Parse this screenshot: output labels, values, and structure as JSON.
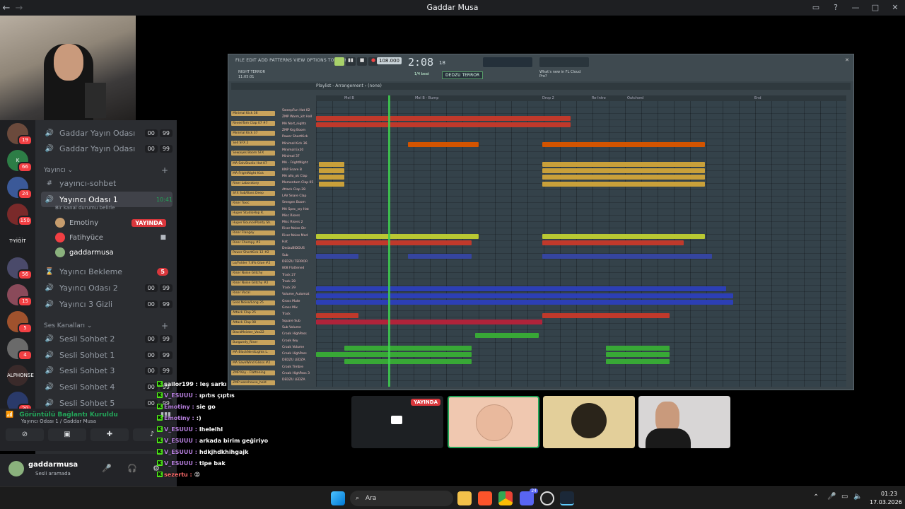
{
  "window": {
    "title": "Gaddar Musa"
  },
  "servers": [
    {
      "badge": "19",
      "color": "#6b4a3c"
    },
    {
      "badge": "66",
      "color": "#2d7d46",
      "label": "K"
    },
    {
      "badge": "24",
      "color": "#3b5998"
    },
    {
      "badge": "150",
      "color": "#7a2a2a"
    },
    {
      "label": "T-YİĞİT",
      "color": "#1e1f22"
    },
    {
      "badge": "56",
      "color": "#4a4a6a"
    },
    {
      "badge": "15",
      "color": "#8a4a5a"
    },
    {
      "badge": "5",
      "color": "#a0522d"
    },
    {
      "badge": "4",
      "color": "#6a6a6a"
    },
    {
      "label": "ALPHONSE",
      "color": "#3a2a2a"
    },
    {
      "badge": "20",
      "color": "#2a3a6a"
    }
  ],
  "channels": {
    "top_items": [
      {
        "label": "Gaddar Yayın Odası",
        "left": "00",
        "right": "99"
      },
      {
        "label": "Gaddar Yayın Odası",
        "left": "00",
        "right": "99"
      }
    ],
    "streamer_category": "Yayıncı",
    "text_channel": "yayıncı-sohbet",
    "active_room": {
      "label": "Yayıncı Odası 1",
      "time": "10:41",
      "status": "Bir kanal durumu belirle"
    },
    "users": [
      {
        "name": "Emotiny",
        "live": "YAYINDA",
        "color": "#c69c6d"
      },
      {
        "name": "Fatihyüce",
        "color": "#f23f43"
      },
      {
        "name": "gaddarmusa",
        "color": "#8ab17d"
      }
    ],
    "waiting": {
      "label": "Yayıncı Bekleme",
      "badge": "5"
    },
    "rooms": [
      {
        "label": "Yayıncı Odası 2",
        "left": "00",
        "right": "99"
      },
      {
        "label": "Yayıncı 3 Gizli",
        "left": "00",
        "right": "99"
      }
    ],
    "voice_category": "Ses Kanalları",
    "voice_rooms": [
      {
        "label": "Sesli Sohbet 2",
        "left": "00",
        "right": "99"
      },
      {
        "label": "Sesli Sohbet 1",
        "left": "00",
        "right": "99"
      },
      {
        "label": "Sesli Sohbet 3",
        "left": "00",
        "right": "99"
      },
      {
        "label": "Sesli Sohbet 4",
        "left": "00",
        "right": "99"
      },
      {
        "label": "Sesli Sohbet 5",
        "left": "00",
        "right": "99"
      }
    ]
  },
  "voice_panel": {
    "status": "Görüntülü Bağlantı Kuruldu",
    "location": "Yayıncı Odası 1 / Gaddar Musa"
  },
  "user_panel": {
    "name": "gaddarmusa",
    "status": "Sesli aramada"
  },
  "chat": [
    {
      "user": "sailor199",
      "msg": "leş sarkı",
      "color": "#ffffff"
    },
    {
      "user": "V_ESUUU",
      "msg": "ıpıtıs çıptıs",
      "color": "#b57edc"
    },
    {
      "user": "Emotiny",
      "msg": "sie go",
      "color": "#b57edc"
    },
    {
      "user": "Emotiny",
      "msg": ":)",
      "color": "#b57edc"
    },
    {
      "user": "V_ESUUU",
      "msg": "lhelelhl",
      "color": "#b57edc"
    },
    {
      "user": "V_ESUUU",
      "msg": "arkada birim geğiriyo",
      "color": "#b57edc"
    },
    {
      "user": "V_ESUUU",
      "msg": "hdkjhdkhihgajk",
      "color": "#b57edc"
    },
    {
      "user": "V_ESUUU",
      "msg": "tipe bak",
      "color": "#b57edc"
    },
    {
      "user": "sezertu",
      "msg": "😡",
      "color": "#ff6b6b"
    }
  ],
  "fl": {
    "menu": "FILE EDIT ADD PATTERNS VIEW OPTIONS TOOLS HELP",
    "tempo": "108.000",
    "time": "2:08",
    "time_sub": "18",
    "pattern": "DEDZU TERROR",
    "snap": "1/4 beat",
    "hint": "What's new in FL Cloud Pro?",
    "project": "NIGHT TERROR",
    "project_sub": "11:05:01",
    "playlist_title": "Playlist - Arrangement",
    "playlist_sub": "(none)",
    "ruler_marks": [
      "Mel B",
      "Mel B - Bump",
      "Drop 2",
      "Re-Intro",
      "Outchord",
      "End"
    ],
    "tracks": [
      "Minimal Kick 36",
      "ReveeTom Clap 07 #7",
      "Minimal Kick 37",
      "Sell SFX 2",
      "Sewayes Boom SFX",
      "MA SalvStudio Hat 07",
      "MA FrightNight Kick",
      "Riser Laboratory",
      "SFX Sub/Bass Deep",
      "Riser Toxic",
      "Huper StudioHop R.",
      "Huper BouncePlanty Sh.",
      "Riser Flangey",
      "Riser Chempy #2",
      "Power ShortKick 12 #2",
      "Lo/Folder 7.8% Glue #2",
      "Riser Noise Glitchy",
      "Riser Noise Glitchy #2",
      "Riser Vocal",
      "Gros Noise/Long 25",
      "Attack Clap 25",
      "Attack Clap 08",
      "BlackMeister_Vox22",
      "Burgundy_Riser",
      "MA BlackNerdLights L.",
      "MA SaveWind Glisss #2",
      "ZMP Key - Flattening",
      "ZMP warehouse_hold"
    ],
    "patterns": [
      "SweepFun Hat 02",
      "ZMP Warm_kit Hall",
      "MA Nort_nights",
      "ZMP Krg Boom",
      "Power ShortKick",
      "Minimal Kick 36",
      "Minimal Ex20",
      "Minimal 37",
      "MA - FrightNight",
      "KNP Snare B",
      "MA allo_ok Clap",
      "Momentum Clap 05",
      "Attack Clap 28",
      "LAV Snare Clap",
      "Smegen Boom",
      "MA Spec_sry Hat",
      "Misc Risers",
      "Misc Risers 2",
      "Riser Noise Gtr",
      "Riser Noise Mod",
      "Hat",
      "DedzuBIDOUS",
      "Sub",
      "DEDZU TERROR",
      "808 Flattened",
      "Track 27",
      "Track 28",
      "Track 29",
      "Volume_Automat",
      "Gross Mute",
      "Gross Mix",
      "Track",
      "Square Sub",
      "Sub Volume",
      "Croak HighPass",
      "Croak Key",
      "Croak Volume",
      "Croak HighPass",
      "DEDZU LEDZA",
      "Croak Timbre",
      "Croak HighPass 3",
      "DEDZU LEDZA"
    ]
  },
  "thumbs": [
    {
      "name": "screen-share",
      "live": "YAYINDA"
    },
    {
      "name": "cartoon-avatar"
    },
    {
      "name": "logo-avatar"
    },
    {
      "name": "camera-feed"
    }
  ],
  "taskbar": {
    "search": "Ara",
    "time": "01:23",
    "date": "17.03.2026",
    "badge": "24"
  }
}
